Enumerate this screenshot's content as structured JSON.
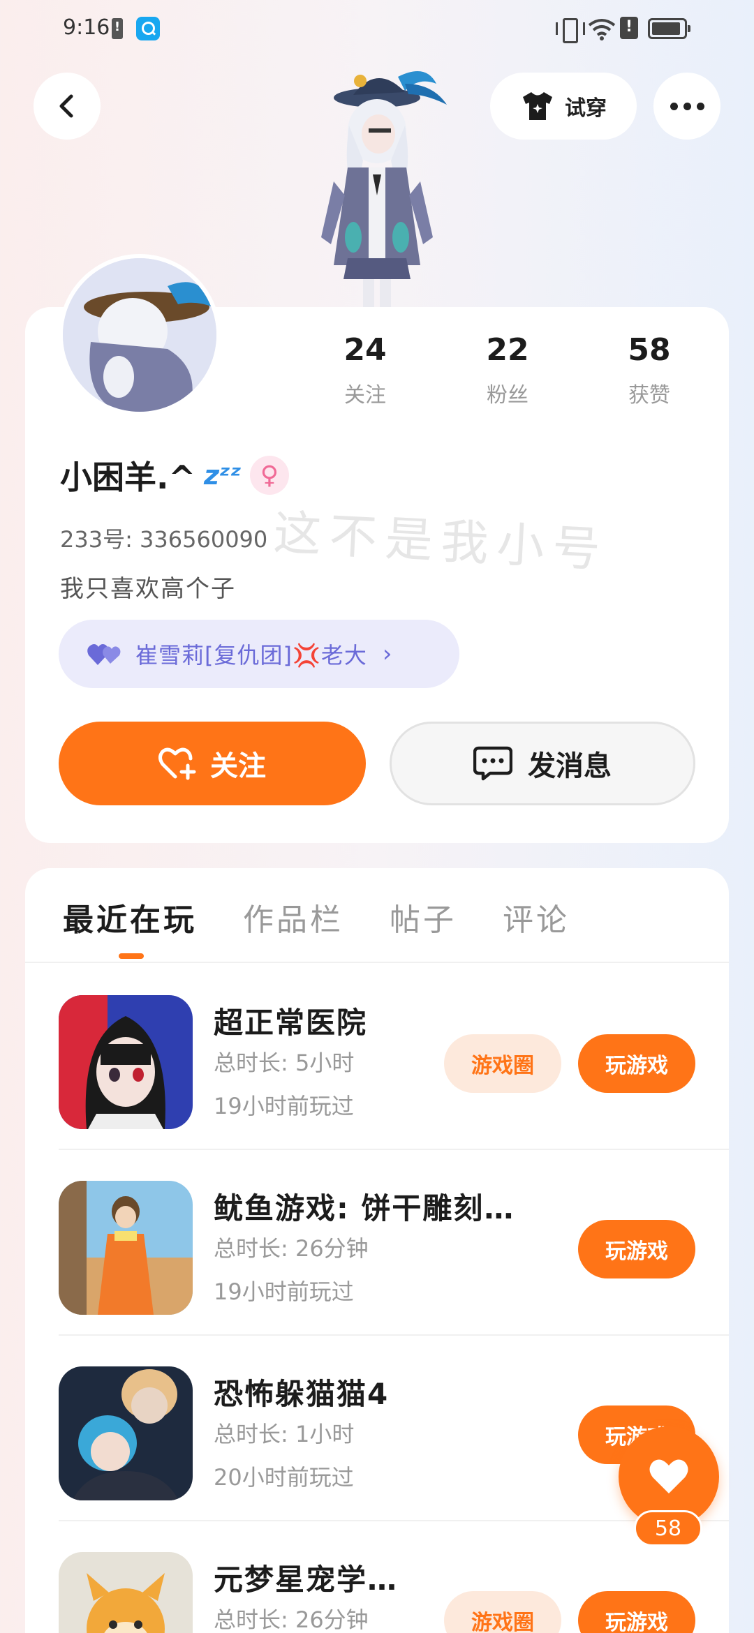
{
  "status_bar": {
    "time": "9:16"
  },
  "header": {
    "try_on_label": "试穿"
  },
  "profile": {
    "stats": [
      {
        "value": "24",
        "label": "关注"
      },
      {
        "value": "22",
        "label": "粉丝"
      },
      {
        "value": "58",
        "label": "获赞"
      }
    ],
    "username": "小困羊.^",
    "username_emoji": "zᶻᶻ",
    "gender_symbol": "♀",
    "uid": "233号: 336560090",
    "watermark_text": "这不是我小号",
    "bio": "我只喜欢高个子",
    "group_label": "崔雪莉[复仇团]💢老大",
    "follow_label": "关注",
    "message_label": "发消息"
  },
  "tabs": [
    {
      "label": "最近在玩",
      "active": true
    },
    {
      "label": "作品栏",
      "active": false
    },
    {
      "label": "帖子",
      "active": false
    },
    {
      "label": "评论",
      "active": false
    }
  ],
  "games": [
    {
      "name": "超正常医院",
      "duration": "总时长: 5小时",
      "last_played": "19小时前玩过",
      "circle_label": "游戏圈",
      "play_label": "玩游戏"
    },
    {
      "name": "鱿鱼游戏: 饼干雕刻…",
      "duration": "总时长: 26分钟",
      "last_played": "19小时前玩过",
      "play_label": "玩游戏"
    },
    {
      "name": "恐怖躲猫猫4",
      "duration": "总时长: 1小时",
      "last_played": "20小时前玩过",
      "play_label": "玩游戏"
    },
    {
      "name": "元梦星宠学…",
      "duration": "总时长: 26分钟",
      "last_played": "",
      "circle_label": "游戏圈",
      "play_label": "玩游戏"
    }
  ],
  "like_fab": {
    "count": "58"
  },
  "colors": {
    "accent": "#ff7417",
    "group_pill": "#ebebfb",
    "group_text": "#6a6ad8"
  }
}
